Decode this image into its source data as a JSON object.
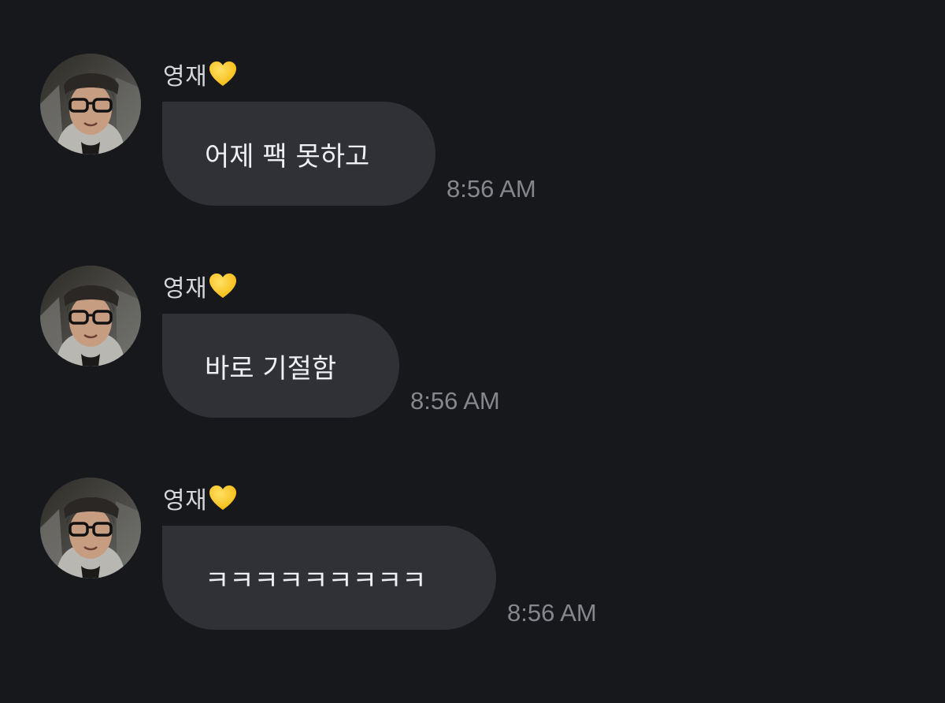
{
  "messages": [
    {
      "sender": "영재",
      "text": "어제 팩 못하고",
      "time": "8:56 AM"
    },
    {
      "sender": "영재",
      "text": "바로 기절함",
      "time": "8:56 AM"
    },
    {
      "sender": "영재",
      "text": "ㅋㅋㅋㅋㅋㅋㅋㅋㅋ",
      "time": "8:56 AM"
    }
  ],
  "icons": {
    "sender_badge": "yellow-heart-icon",
    "avatar": "profile-photo"
  },
  "colors": {
    "background": "#17181c",
    "bubble": "#2f3137",
    "message_text": "#eeeff2",
    "sender_text": "#d6d7db",
    "timestamp": "#85878d",
    "heart": "#ffcc22"
  }
}
